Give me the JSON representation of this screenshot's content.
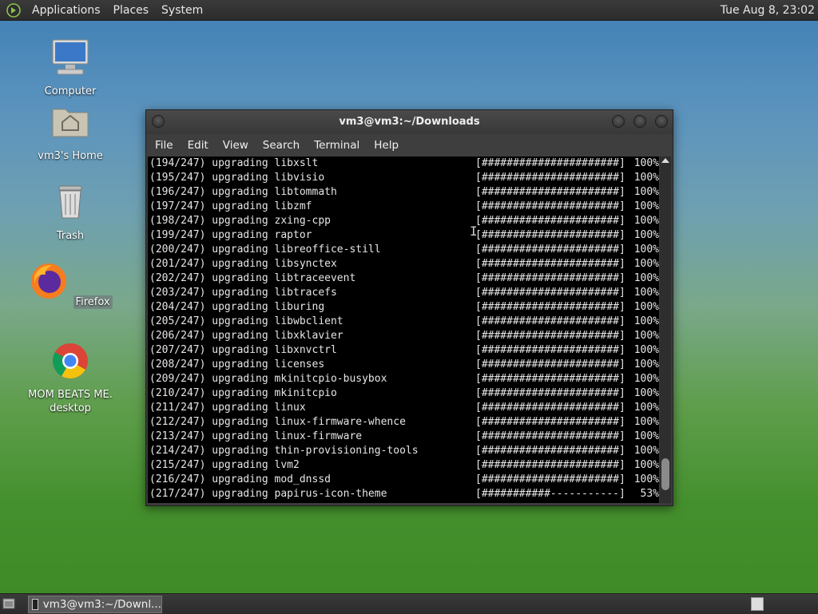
{
  "top_panel": {
    "menus": [
      "Applications",
      "Places",
      "System"
    ],
    "clock": "Tue Aug  8, 23:02"
  },
  "desktop_icons": [
    {
      "label": "Computer",
      "icon": "computer-icon"
    },
    {
      "label": "vm3's Home",
      "icon": "home-folder-icon"
    },
    {
      "label": "Trash",
      "icon": "trash-icon"
    },
    {
      "label": "Firefox",
      "icon": "firefox-icon"
    },
    {
      "label": "MOM BEATS ME.\ndesktop",
      "icon": "chrome-icon"
    }
  ],
  "terminal": {
    "title": "vm3@vm3:~/Downloads",
    "menus": [
      "File",
      "Edit",
      "View",
      "Search",
      "Terminal",
      "Help"
    ],
    "lines": [
      {
        "text": "(194/247) upgrading libxslt",
        "bar": "[######################]",
        "pct": "100%"
      },
      {
        "text": "(195/247) upgrading libvisio",
        "bar": "[######################]",
        "pct": "100%"
      },
      {
        "text": "(196/247) upgrading libtommath",
        "bar": "[######################]",
        "pct": "100%"
      },
      {
        "text": "(197/247) upgrading libzmf",
        "bar": "[######################]",
        "pct": "100%"
      },
      {
        "text": "(198/247) upgrading zxing-cpp",
        "bar": "[######################]",
        "pct": "100%"
      },
      {
        "text": "(199/247) upgrading raptor",
        "bar": "[######################]",
        "pct": "100%"
      },
      {
        "text": "(200/247) upgrading libreoffice-still",
        "bar": "[######################]",
        "pct": "100%"
      },
      {
        "text": "(201/247) upgrading libsynctex",
        "bar": "[######################]",
        "pct": "100%"
      },
      {
        "text": "(202/247) upgrading libtraceevent",
        "bar": "[######################]",
        "pct": "100%"
      },
      {
        "text": "(203/247) upgrading libtracefs",
        "bar": "[######################]",
        "pct": "100%"
      },
      {
        "text": "(204/247) upgrading liburing",
        "bar": "[######################]",
        "pct": "100%"
      },
      {
        "text": "(205/247) upgrading libwbclient",
        "bar": "[######################]",
        "pct": "100%"
      },
      {
        "text": "(206/247) upgrading libxklavier",
        "bar": "[######################]",
        "pct": "100%"
      },
      {
        "text": "(207/247) upgrading libxnvctrl",
        "bar": "[######################]",
        "pct": "100%"
      },
      {
        "text": "(208/247) upgrading licenses",
        "bar": "[######################]",
        "pct": "100%"
      },
      {
        "text": "(209/247) upgrading mkinitcpio-busybox",
        "bar": "[######################]",
        "pct": "100%"
      },
      {
        "text": "(210/247) upgrading mkinitcpio",
        "bar": "[######################]",
        "pct": "100%"
      },
      {
        "text": "(211/247) upgrading linux",
        "bar": "[######################]",
        "pct": "100%"
      },
      {
        "text": "(212/247) upgrading linux-firmware-whence",
        "bar": "[######################]",
        "pct": "100%"
      },
      {
        "text": "(213/247) upgrading linux-firmware",
        "bar": "[######################]",
        "pct": "100%"
      },
      {
        "text": "(214/247) upgrading thin-provisioning-tools",
        "bar": "[######################]",
        "pct": "100%"
      },
      {
        "text": "(215/247) upgrading lvm2",
        "bar": "[######################]",
        "pct": "100%"
      },
      {
        "text": "(216/247) upgrading mod_dnssd",
        "bar": "[######################]",
        "pct": "100%"
      },
      {
        "text": "(217/247) upgrading papirus-icon-theme",
        "bar": "[###########-----------]",
        "pct": "53%"
      }
    ]
  },
  "taskbar": {
    "window_button": "vm3@vm3:~/Downl..."
  },
  "colors": {
    "terminal_bg": "#000000",
    "terminal_fg": "#e6e6e6",
    "panel_bg": "#333333"
  }
}
